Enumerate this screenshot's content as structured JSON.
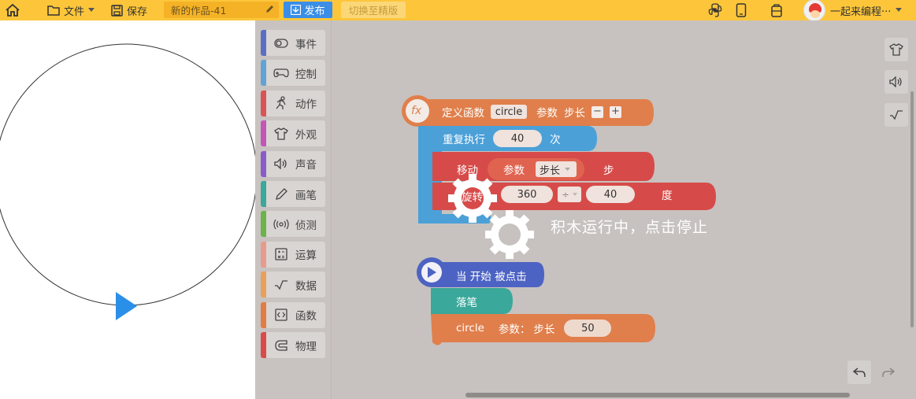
{
  "topbar": {
    "file_label": "文件",
    "save_label": "保存",
    "title": "新的作品-41",
    "publish_label": "发布",
    "switch_label": "切换至精版",
    "user_name": "一起来编程···"
  },
  "palette": {
    "items": [
      {
        "label": "事件",
        "color": "#5b6fc2",
        "icon": "toggle-icon"
      },
      {
        "label": "控制",
        "color": "#62a3d6",
        "icon": "gamepad-icon"
      },
      {
        "label": "动作",
        "color": "#d95454",
        "icon": "running-icon"
      },
      {
        "label": "外观",
        "color": "#c257b8",
        "icon": "shirt-icon"
      },
      {
        "label": "声音",
        "color": "#8a5cc9",
        "icon": "speaker-icon"
      },
      {
        "label": "画笔",
        "color": "#3aa89a",
        "icon": "pen-icon"
      },
      {
        "label": "侦测",
        "color": "#6bb34a",
        "icon": "signal-icon"
      },
      {
        "label": "运算",
        "color": "#e89a8c",
        "icon": "calculator-icon"
      },
      {
        "label": "数据",
        "color": "#e8a05a",
        "icon": "data-icon"
      },
      {
        "label": "函数",
        "color": "#e37c44",
        "icon": "code-icon"
      },
      {
        "label": "物理",
        "color": "#d94b4b",
        "icon": "magnet-icon"
      }
    ]
  },
  "blocks": {
    "define": {
      "label": "定义函数",
      "name": "circle",
      "param_label": "参数",
      "param_name": "步长",
      "minus": "−",
      "plus": "+",
      "fx": "fx"
    },
    "repeat": {
      "label": "重复执行",
      "count": "40",
      "suffix": "次"
    },
    "move": {
      "label": "移动",
      "param_label": "参数",
      "param_value": "步长",
      "suffix": "步"
    },
    "turn": {
      "label": "旋转",
      "value_a": "360",
      "operator": "÷",
      "value_b": "40",
      "suffix": "度"
    },
    "when_start": {
      "label": "当 开始 被点击"
    },
    "pen_down": {
      "label": "落笔"
    },
    "call": {
      "name": "circle",
      "param_label": "参数：",
      "param_name": "步长",
      "value": "50"
    }
  },
  "overlay": {
    "message": "积木运行中，点击停止"
  },
  "colors": {
    "topbar": "#fdc63a",
    "publish": "#3a8ee6",
    "sprite": "#2a8fe8"
  }
}
